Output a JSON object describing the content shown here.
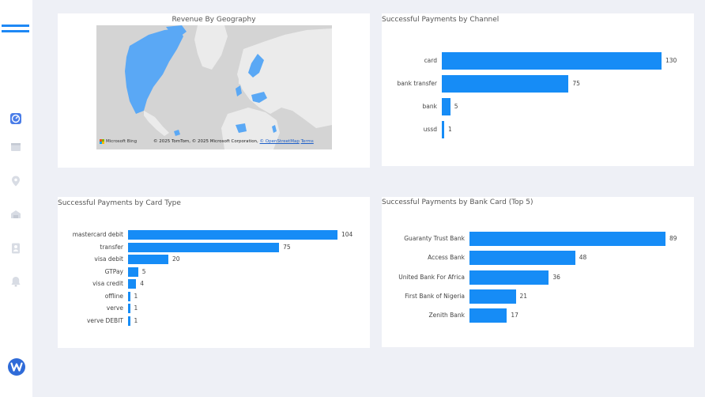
{
  "theme": {
    "accent": "#168cf6",
    "page_bg": "#eef0f6",
    "card_bg": "#ffffff",
    "map_land_highlight": "#5aa8f5"
  },
  "sidebar": {
    "menu_icon": "hamburger-icon",
    "items": [
      {
        "icon": "dashboard-icon",
        "active": true
      },
      {
        "icon": "table-icon",
        "active": false
      },
      {
        "icon": "location-pin-icon",
        "active": false
      },
      {
        "icon": "bank-icon",
        "active": false
      },
      {
        "icon": "user-icon",
        "active": false
      },
      {
        "icon": "bell-icon",
        "active": false
      }
    ],
    "logo_icon": "brand-logo-icon"
  },
  "map_card": {
    "title": "Revenue By Geography",
    "provider": "Microsoft Bing",
    "attribution": "© 2025 TomTom, © 2025 Microsoft Corporation, ",
    "osm_link": "© OpenStreetMap",
    "terms_link": "Terms"
  },
  "channel_card": {
    "title": "Successful Payments by Channel",
    "chart_data": {
      "type": "bar",
      "orientation": "horizontal",
      "categories": [
        "card",
        "bank transfer",
        "bank",
        "ussd"
      ],
      "values": [
        130,
        75,
        5,
        1
      ],
      "labels": [
        "130",
        "75",
        "5",
        "1"
      ]
    }
  },
  "card_type_card": {
    "title": "Successful Payments by Card Type",
    "chart_data": {
      "type": "bar",
      "orientation": "horizontal",
      "categories": [
        "mastercard debit",
        "transfer",
        "visa debit",
        "GTPay",
        "visa credit",
        "offline",
        "verve",
        "verve DEBIT"
      ],
      "values": [
        104,
        75,
        20,
        5,
        4,
        1,
        1,
        1
      ],
      "labels": [
        "104",
        "75",
        "20",
        "5",
        "4",
        "1",
        "1",
        "1"
      ]
    }
  },
  "bank_card": {
    "title": "Successful Payments by Bank Card (Top 5)",
    "chart_data": {
      "type": "bar",
      "orientation": "horizontal",
      "categories": [
        "Guaranty Trust Bank",
        "Access Bank",
        "United Bank For Africa",
        "First Bank of Nigeria",
        "Zenith Bank"
      ],
      "values": [
        89,
        48,
        36,
        21,
        17
      ],
      "labels": [
        "89",
        "48",
        "36",
        "21",
        "17"
      ]
    }
  }
}
